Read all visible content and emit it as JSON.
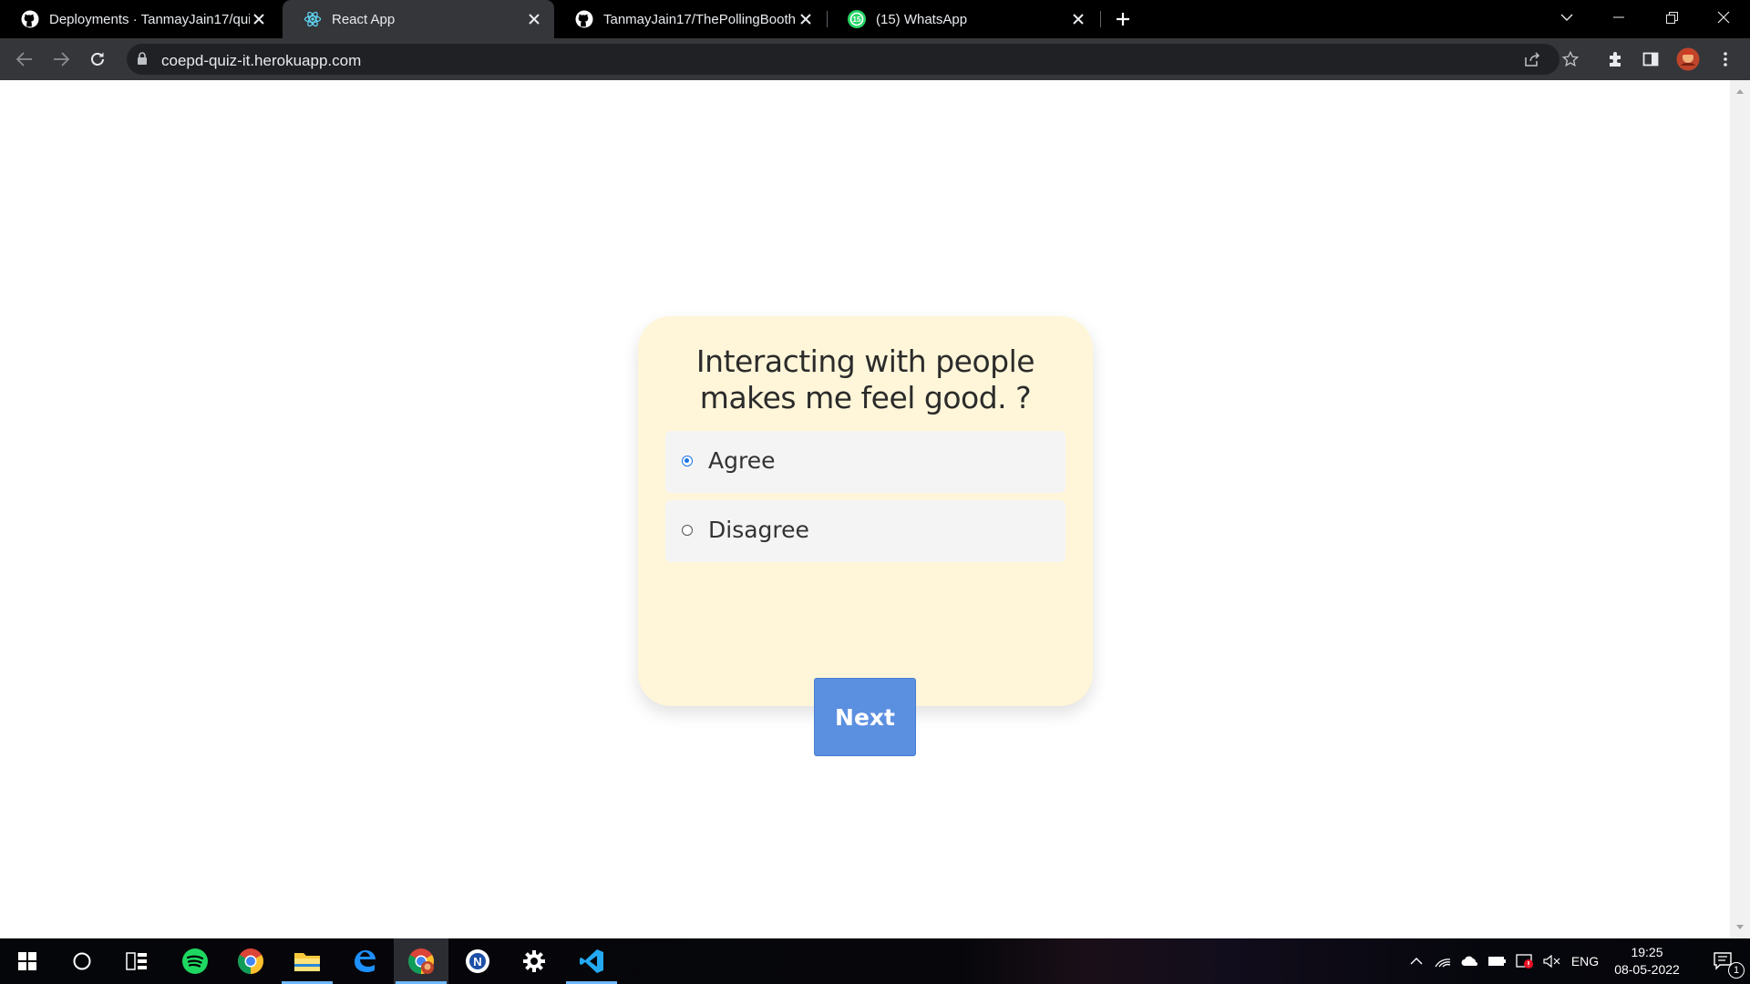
{
  "browser": {
    "tabs": [
      {
        "title": "Deployments · TanmayJain17/qui",
        "icon": "github-icon",
        "active": false
      },
      {
        "title": "React App",
        "icon": "react-icon",
        "active": true
      },
      {
        "title": "TanmayJain17/ThePollingBooth",
        "icon": "github-icon",
        "active": false
      },
      {
        "title": "(15) WhatsApp",
        "icon": "whatsapp-icon",
        "active": false,
        "badge": "15"
      }
    ],
    "url": "coepd-quiz-it.herokuapp.com"
  },
  "quiz": {
    "question": "Interacting with people makes me feel good. ?",
    "options": [
      {
        "label": "Agree",
        "selected": true
      },
      {
        "label": "Disagree",
        "selected": false
      }
    ],
    "next_label": "Next"
  },
  "taskbar": {
    "apps": [
      "windows-start-icon",
      "search-icon",
      "task-view-icon",
      "spotify-icon",
      "chrome-icon",
      "file-explorer-icon",
      "edge-icon",
      "chrome-profile-icon",
      "app-icon",
      "settings-icon",
      "vscode-icon"
    ],
    "language": "ENG",
    "time": "19:25",
    "date": "08-05-2022",
    "notification_count": "1"
  },
  "colors": {
    "card_bg": "#fff6d9",
    "next_button": "#5b8fe0",
    "radio_selected": "#1a73e8"
  }
}
